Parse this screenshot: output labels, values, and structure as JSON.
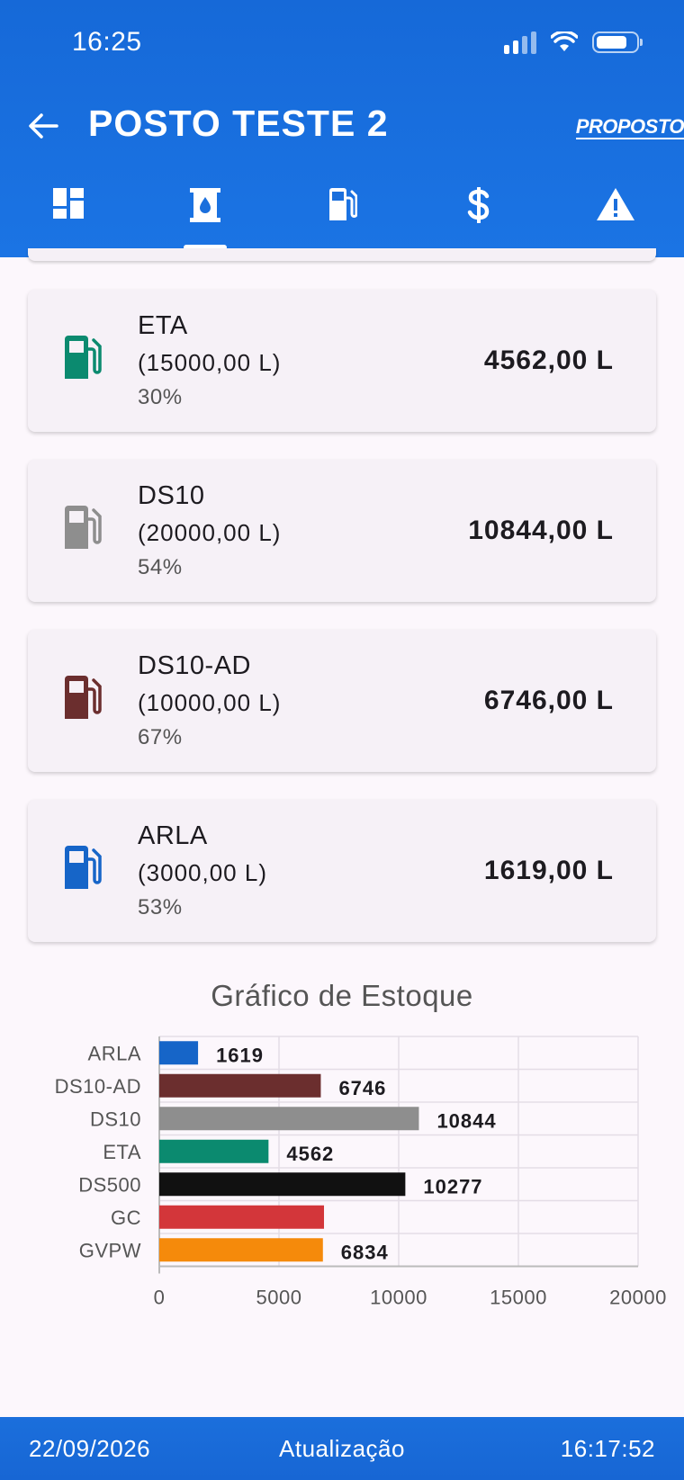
{
  "status_bar": {
    "time": "16:25"
  },
  "header": {
    "title": "POSTO TESTE 2",
    "logo": "PROPOSTO"
  },
  "tabs": [
    {
      "icon": "dashboard-icon",
      "active": false
    },
    {
      "icon": "tank-icon",
      "active": true
    },
    {
      "icon": "fuel-pump-icon",
      "active": false
    },
    {
      "icon": "dollar-icon",
      "active": false
    },
    {
      "icon": "warning-icon",
      "active": false
    }
  ],
  "tanks": [
    {
      "name": "ETA",
      "capacity": "(15000,00 L)",
      "percent": "30%",
      "quantity": "4562,00 L",
      "color": "#0b8a6f"
    },
    {
      "name": "DS10",
      "capacity": "(20000,00 L)",
      "percent": "54%",
      "quantity": "10844,00 L",
      "color": "#8e8e8e"
    },
    {
      "name": "DS10-AD",
      "capacity": "(10000,00 L)",
      "percent": "67%",
      "quantity": "6746,00 L",
      "color": "#6b2e2e"
    },
    {
      "name": "ARLA",
      "capacity": "(3000,00 L)",
      "percent": "53%",
      "quantity": "1619,00 L",
      "color": "#1665c8"
    }
  ],
  "chart_data": {
    "type": "bar",
    "orientation": "horizontal",
    "title": "Gráfico de Estoque",
    "categories": [
      "ARLA",
      "DS10-AD",
      "DS10",
      "ETA",
      "DS500",
      "GC",
      "GVPW"
    ],
    "values": [
      1619,
      6746,
      10844,
      4562,
      10277,
      6880,
      6834
    ],
    "value_labels": [
      "1619",
      "6746",
      "10844",
      "4562",
      "10277",
      "",
      "6834"
    ],
    "colors": [
      "#1665c8",
      "#6b2e2e",
      "#8e8e8e",
      "#0b8a6f",
      "#111111",
      "#d3363a",
      "#f58a0b"
    ],
    "xlim": [
      0,
      20000
    ],
    "xticks": [
      0,
      5000,
      10000,
      15000,
      20000
    ],
    "grid": true
  },
  "footer": {
    "date": "22/09/2026",
    "label": "Atualização",
    "time": "16:17:52"
  }
}
